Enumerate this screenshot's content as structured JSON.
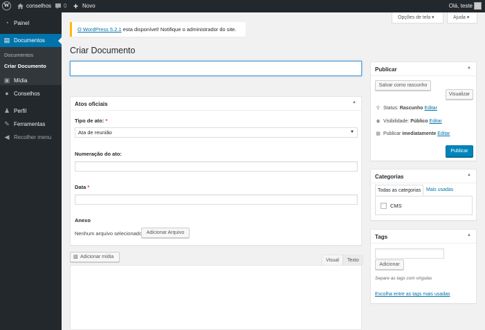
{
  "adminbar": {
    "site_name": "conselhos",
    "comment_count": "0",
    "new_plus": "+",
    "new_label": "Novo",
    "howdy": "Olá, teste"
  },
  "sidebar": {
    "painel": "Painel",
    "documentos": "Documentos",
    "sub_documentos": "Documentos",
    "sub_criar": "Criar Documento",
    "midia": "Mídia",
    "conselhos": "Conselhos",
    "perfil": "Perfil",
    "ferramentas": "Ferramentas",
    "recolher": "Recolher menu"
  },
  "screen_meta": {
    "options": "Opções de tela ▾",
    "help": "Ajuda ▾"
  },
  "notice": {
    "link": "O WordPress 5.2.1",
    "text": " esta disponível! Notifique o administrador do site."
  },
  "page_title": "Criar Documento",
  "atos": {
    "title": "Atos oficiais",
    "tipo_label": "Tipo de ato: ",
    "tipo_value": "Ata de reunião",
    "numeracao_label": "Numeração do ato:",
    "data_label": "Data ",
    "required_mark": "*",
    "anexo_label": "Anexo",
    "anexo_status": "Nenhum arquivo selecionado",
    "anexo_button": "Adicionar Arquivo"
  },
  "editor": {
    "add_media": "Adicionar mídia",
    "tab_visual": "Visual",
    "tab_text": "Texto"
  },
  "publicar": {
    "title": "Publicar",
    "save_draft": "Salvar como rascunho",
    "preview": "Visualizar",
    "status_label": "Status: ",
    "status_value": "Rascunho",
    "visibility_label": "Visibilidade: ",
    "visibility_value": "Público",
    "publish_label": "Publicar ",
    "publish_value": "imediatamente",
    "edit": "Editar",
    "publish_button": "Publicar"
  },
  "categorias": {
    "title": "Categorias",
    "tab_all": "Todas as categorias",
    "tab_most": "Mais usadas",
    "items": [
      "CMS"
    ]
  },
  "tags": {
    "title": "Tags",
    "add_button": "Adicionar",
    "howto": "Separe as tags com vírgulas",
    "choose_link": "Escolha entre as tags mais usadas"
  },
  "icons": {
    "toggle": "▲",
    "select_arrow": "▼"
  },
  "colors": {
    "accent": "#0073aa",
    "primary_button": "#0085ba",
    "adminbar": "#23282d",
    "notice_border": "#ffb900",
    "required": "#dc3232"
  }
}
